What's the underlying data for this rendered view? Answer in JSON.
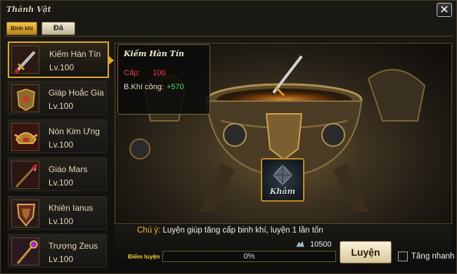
{
  "window": {
    "title": "Thánh Vật",
    "close_label": "✕"
  },
  "tabs": [
    {
      "label": "Binh khí",
      "active": true
    },
    {
      "label": "Đá",
      "active": false
    }
  ],
  "items": [
    {
      "name": "Kiếm Hàn Tín",
      "level": "Lv.100",
      "icon": "sword-icon",
      "selected": true
    },
    {
      "name": "Giáp Hoắc Gia",
      "level": "Lv.100",
      "icon": "armor-icon"
    },
    {
      "name": "Nón Kim Ưng",
      "level": "Lv.100",
      "icon": "helmet-icon"
    },
    {
      "name": "Giáo Mars",
      "level": "Lv.100",
      "icon": "spear-icon"
    },
    {
      "name": "Khiên Ianus",
      "level": "Lv.100",
      "icon": "shield-icon"
    },
    {
      "name": "Trượng Zeus",
      "level": "Lv.100",
      "icon": "staff-icon"
    }
  ],
  "info": {
    "title": "Kiếm Hàn Tín",
    "level_label": "Cấp:",
    "level_value": "100",
    "power_label": "B.Khí công:",
    "power_value": "+570"
  },
  "kham": {
    "label": "Khảm",
    "icon": "gem-icon"
  },
  "forge": {
    "note_label": "Chú ý:",
    "note_text": "Luyện giúp tăng cấp binh khí, luyện 1 lần tốn",
    "cost": "10500",
    "cost_icon": "ore-icon",
    "exp_label": "Điểm luyện",
    "progress_fraction": 0.0,
    "progress_text": "0%",
    "forge_button": "Luyện",
    "fast_label": "Tăng nhanh",
    "fast_checked": false
  },
  "colors": {
    "accent": "#e3a82b",
    "red": "#ff3a3a",
    "green": "#4ee05c",
    "note": "#f0c040"
  }
}
